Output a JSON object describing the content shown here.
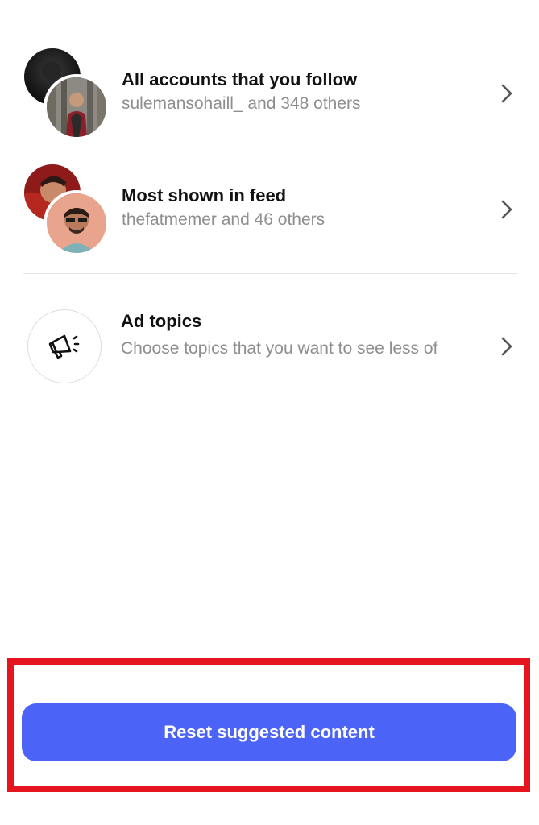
{
  "rows": [
    {
      "title": "All accounts that you follow",
      "subtitle": "sulemansohaill_ and 348 others"
    },
    {
      "title": "Most shown in feed",
      "subtitle": "thefatmemer and 46 others"
    },
    {
      "title": "Ad topics",
      "subtitle": "Choose topics that you want to see less of"
    }
  ],
  "icons": {
    "chevron": "chevron-right-icon",
    "ad": "megaphone-icon"
  },
  "reset_button": {
    "label": "Reset suggested content"
  },
  "colors": {
    "accent": "#4c63f7",
    "highlight": "#e6141e",
    "secondary_text": "#8e8e8e",
    "divider": "#e4e4e4"
  }
}
